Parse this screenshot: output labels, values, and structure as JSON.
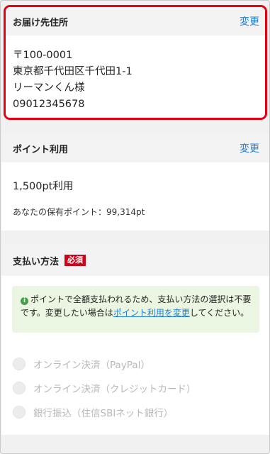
{
  "address": {
    "title": "お届け先住所",
    "change_label": "変更",
    "postal": "〒100-0001",
    "line1": "東京都千代田区千代田1-1",
    "name": "リーマンくん様",
    "phone": "09012345678"
  },
  "points": {
    "title": "ポイント利用",
    "change_label": "変更",
    "used": "1,500pt利用",
    "balance": "あなたの保有ポイント：99,314pt"
  },
  "payment": {
    "title": "支払い方法",
    "required_badge": "必須",
    "notice_text_1": "ポイントで全額支払われるため、支払い方法の選択は不要です。変更したい場合は",
    "notice_link": "ポイント利用を変更",
    "notice_text_2": "してください。",
    "options": [
      {
        "label": "オンライン決済（PayPal）"
      },
      {
        "label": "オンライン決済（クレジットカード）"
      },
      {
        "label": "銀行振込（住信SBIネット銀行）"
      }
    ]
  },
  "colors": {
    "highlight_border": "#e60012",
    "link": "#1f7cd6",
    "badge": "#d0021b",
    "notice_bg": "#eaf6e1",
    "info_icon": "#43a047"
  }
}
